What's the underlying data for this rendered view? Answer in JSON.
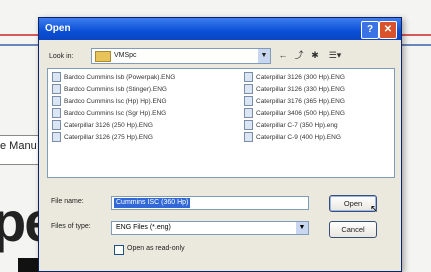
{
  "background": {
    "side_label": "e Manu",
    "big_text": "pe"
  },
  "dialog": {
    "title": "Open",
    "help_button": "?",
    "close_button": "✕",
    "look_in_label": "Look in:",
    "look_in_value": "VMSpc",
    "toolbar": [
      "←",
      "⤴",
      "✱",
      "☰▾"
    ],
    "files_left": [
      "Bardco Cummins Isb (Powerpak).ENG",
      "Bardco Cummins Isb (Stinger).ENG",
      "Bardco Cummins Isc (Hp) Hp).ENG",
      "Bardco Cummins Isc (Sgr Hp).ENG",
      "Caterpillar 3126 (250 Hp).ENG",
      "Caterpillar 3126 (275 Hp).ENG"
    ],
    "files_right": [
      "Caterpillar 3126 (300 Hp).ENG",
      "Caterpillar 3126 (330 Hp).ENG",
      "Caterpillar 3176 (365 Hp).ENG",
      "Caterpillar 3406 (500 Hp).ENG",
      "Caterpillar C-7 (350 Hp).eng",
      "Caterpillar C-9 (400 Hp).ENG"
    ],
    "file_name_label": "File name:",
    "file_name_value": "Cummins ISC (360 Hp)",
    "files_of_type_label": "Files of type:",
    "files_of_type_value": "ENG Files (*.eng)",
    "open_button": "Open",
    "cancel_button": "Cancel",
    "read_only_label": "Open as read-only"
  }
}
